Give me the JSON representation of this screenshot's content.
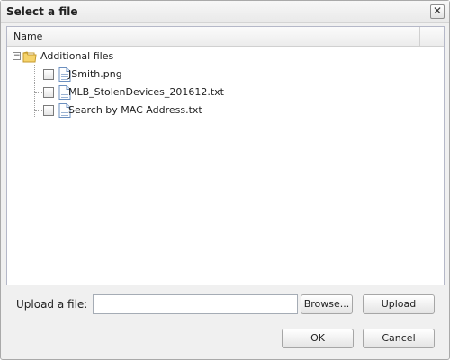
{
  "dialog": {
    "title": "Select a file",
    "close_glyph": "✕"
  },
  "file_list": {
    "column_header": "Name",
    "folder": {
      "name": "Additional files",
      "expanded": true,
      "expander_glyph": "−",
      "icon": "folder-icon"
    },
    "files": [
      {
        "name": "JSmith.png",
        "checked": false,
        "icon": "file-icon"
      },
      {
        "name": "MLB_StolenDevices_201612.txt",
        "checked": false,
        "icon": "file-icon"
      },
      {
        "name": "Search by MAC Address.txt",
        "checked": false,
        "icon": "file-icon"
      }
    ]
  },
  "upload": {
    "label": "Upload a file:",
    "value": "",
    "browse_label": "Browse...",
    "upload_label": "Upload"
  },
  "actions": {
    "ok_label": "OK",
    "cancel_label": "Cancel"
  }
}
